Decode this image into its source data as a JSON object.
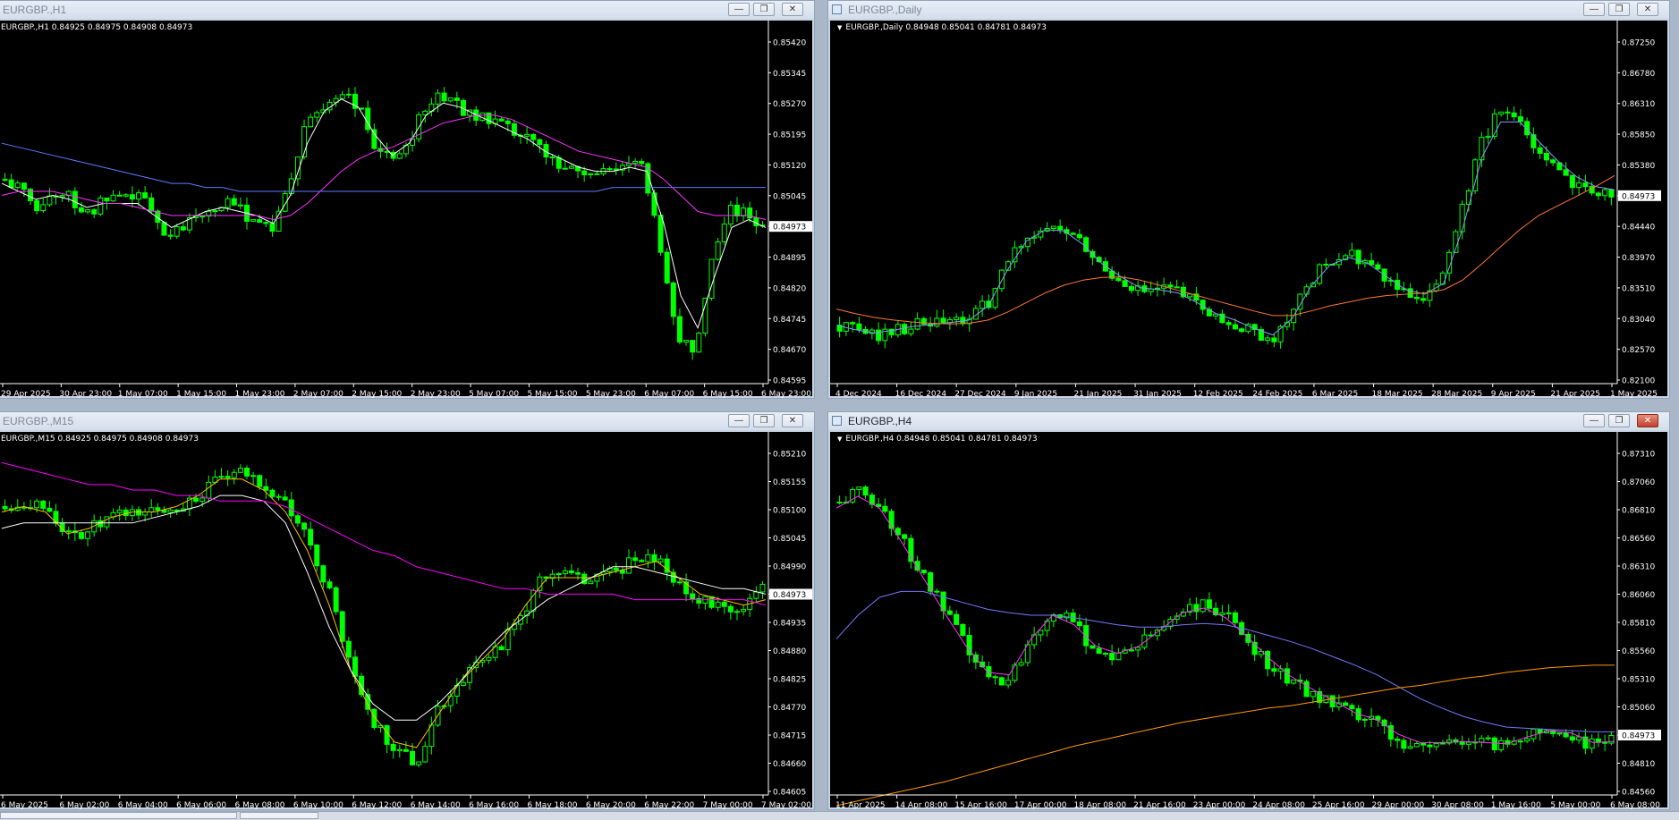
{
  "windows": [
    {
      "id": "h1",
      "title": "EURGBP.,H1",
      "info": "EURGBP.,H1  0.84925 0.84975 0.84908 0.84973",
      "active": false,
      "price_labels": [
        "0.85420",
        "0.85345",
        "0.85270",
        "0.85195",
        "0.85120",
        "0.85045",
        "0.84973",
        "0.84895",
        "0.84820",
        "0.84745",
        "0.84670",
        "0.84595"
      ],
      "current_price": "0.84973",
      "time_labels": [
        "29 Apr 2025",
        "30 Apr 23:00",
        "1 May 07:00",
        "1 May 15:00",
        "1 May 23:00",
        "2 May 07:00",
        "2 May 15:00",
        "2 May 23:00",
        "5 May 07:00",
        "5 May 15:00",
        "5 May 23:00",
        "6 May 07:00",
        "6 May 15:00",
        "6 May 23:00"
      ],
      "chart_data": {
        "type": "candlestick",
        "symbol": "EURGBP.",
        "timeframe": "H1",
        "ylim": [
          0.8459,
          0.8545
        ],
        "close_path": [
          0.8509,
          0.8506,
          0.8502,
          0.8506,
          0.8504,
          0.85,
          0.8504,
          0.8503,
          0.8506,
          0.8498,
          0.8495,
          0.85,
          0.8502,
          0.8503,
          0.8501,
          0.8499,
          0.8497,
          0.8509,
          0.8524,
          0.8527,
          0.8531,
          0.8527,
          0.8517,
          0.8513,
          0.8519,
          0.8528,
          0.853,
          0.8527,
          0.8525,
          0.8523,
          0.8521,
          0.8519,
          0.8516,
          0.8513,
          0.8511,
          0.851,
          0.8512,
          0.8513,
          0.8511,
          0.849,
          0.847,
          0.8466,
          0.849,
          0.8502,
          0.85,
          0.8497
        ],
        "ma_fast": [
          0.8508,
          0.8506,
          0.8504,
          0.8505,
          0.8504,
          0.8502,
          0.8503,
          0.8503,
          0.8503,
          0.85,
          0.8497,
          0.8499,
          0.8501,
          0.8502,
          0.8501,
          0.85,
          0.8498,
          0.8505,
          0.8518,
          0.8526,
          0.8529,
          0.8527,
          0.852,
          0.8515,
          0.8518,
          0.8525,
          0.8528,
          0.8527,
          0.8525,
          0.8523,
          0.8521,
          0.8519,
          0.8516,
          0.8514,
          0.8512,
          0.8511,
          0.8511,
          0.8512,
          0.8511,
          0.8498,
          0.848,
          0.8472,
          0.8485,
          0.8497,
          0.8499,
          0.8497
        ],
        "ma_mid": [
          0.8505,
          0.8506,
          0.8506,
          0.8506,
          0.8505,
          0.8504,
          0.8503,
          0.8503,
          0.8502,
          0.8501,
          0.85,
          0.85,
          0.85,
          0.85,
          0.85,
          0.85,
          0.8499,
          0.85,
          0.8503,
          0.8507,
          0.8511,
          0.8514,
          0.8516,
          0.8517,
          0.8519,
          0.8521,
          0.8523,
          0.8524,
          0.8525,
          0.8525,
          0.8524,
          0.8522,
          0.852,
          0.8518,
          0.8516,
          0.8515,
          0.8514,
          0.8513,
          0.8512,
          0.8509,
          0.8505,
          0.8501,
          0.85,
          0.85,
          0.85,
          0.8499
        ],
        "ma_slow": [
          0.8518,
          0.8517,
          0.8516,
          0.8515,
          0.8514,
          0.8513,
          0.8512,
          0.8511,
          0.851,
          0.8509,
          0.8508,
          0.8508,
          0.8507,
          0.8507,
          0.8506,
          0.8506,
          0.8506,
          0.8506,
          0.8506,
          0.8506,
          0.8506,
          0.8506,
          0.8506,
          0.8506,
          0.8506,
          0.8506,
          0.8506,
          0.8506,
          0.8506,
          0.8506,
          0.8506,
          0.8506,
          0.8506,
          0.8506,
          0.8506,
          0.8506,
          0.8507,
          0.8507,
          0.8507,
          0.8507,
          0.8507,
          0.8507,
          0.8507,
          0.8507,
          0.8507,
          0.8507
        ]
      }
    },
    {
      "id": "daily",
      "title": "EURGBP.,Daily",
      "info": "EURGBP.,Daily  0.84948 0.85041 0.84781 0.84973",
      "active": false,
      "price_labels": [
        "0.87250",
        "0.86780",
        "0.86310",
        "0.85850",
        "0.85380",
        "0.84973",
        "0.84440",
        "0.83970",
        "0.83510",
        "0.83040",
        "0.82570",
        "0.82100"
      ],
      "current_price": "0.84973",
      "time_labels": [
        "4 Dec 2024",
        "16 Dec 2024",
        "27 Dec 2024",
        "9 Jan 2025",
        "21 Jan 2025",
        "31 Jan 2025",
        "12 Feb 2025",
        "24 Feb 2025",
        "6 Mar 2025",
        "18 Mar 2025",
        "28 Mar 2025",
        "9 Apr 2025",
        "21 Apr 2025",
        "1 May 2025"
      ],
      "chart_data": {
        "type": "candlestick",
        "symbol": "EURGBP.",
        "timeframe": "Daily",
        "ylim": [
          0.8205,
          0.874
        ],
        "close_path": [
          0.829,
          0.8282,
          0.8275,
          0.8285,
          0.829,
          0.8292,
          0.8295,
          0.83,
          0.833,
          0.839,
          0.843,
          0.844,
          0.8435,
          0.841,
          0.8375,
          0.836,
          0.834,
          0.8345,
          0.834,
          0.832,
          0.83,
          0.8295,
          0.828,
          0.827,
          0.831,
          0.836,
          0.839,
          0.84,
          0.8385,
          0.836,
          0.834,
          0.8335,
          0.836,
          0.846,
          0.857,
          0.862,
          0.861,
          0.857,
          0.854,
          0.851,
          0.85,
          0.8497
        ],
        "ma_fast": [
          0.829,
          0.8283,
          0.8278,
          0.8282,
          0.8288,
          0.8291,
          0.8294,
          0.8298,
          0.832,
          0.8375,
          0.842,
          0.8438,
          0.8436,
          0.8415,
          0.8385,
          0.8365,
          0.8348,
          0.8345,
          0.834,
          0.8325,
          0.8308,
          0.8298,
          0.8285,
          0.8275,
          0.83,
          0.835,
          0.8383,
          0.8395,
          0.8386,
          0.8365,
          0.8345,
          0.8338,
          0.8355,
          0.844,
          0.855,
          0.8605,
          0.8605,
          0.8575,
          0.8545,
          0.852,
          0.8505,
          0.85
        ],
        "ma_slow": [
          0.8315,
          0.8308,
          0.8302,
          0.8298,
          0.8295,
          0.8293,
          0.8292,
          0.8293,
          0.8298,
          0.831,
          0.8325,
          0.834,
          0.8352,
          0.836,
          0.8364,
          0.8365,
          0.836,
          0.8352,
          0.8344,
          0.8336,
          0.8328,
          0.832,
          0.8312,
          0.8305,
          0.8305,
          0.8312,
          0.832,
          0.8326,
          0.8332,
          0.8336,
          0.8338,
          0.834,
          0.8345,
          0.836,
          0.8385,
          0.8412,
          0.8438,
          0.846,
          0.8475,
          0.849,
          0.8505,
          0.8522
        ]
      }
    },
    {
      "id": "m15",
      "title": "EURGBP.,M15",
      "info": "EURGBP.,M15  0.84925 0.84975 0.84908 0.84973",
      "active": false,
      "price_labels": [
        "0.85210",
        "0.85155",
        "0.85100",
        "0.85045",
        "0.84990",
        "0.84973",
        "0.84935",
        "0.84880",
        "0.84825",
        "0.84770",
        "0.84715",
        "0.84660",
        "0.84605"
      ],
      "current_price": "0.84973",
      "time_labels": [
        "6 May 2025",
        "6 May 02:00",
        "6 May 04:00",
        "6 May 06:00",
        "6 May 08:00",
        "6 May 10:00",
        "6 May 12:00",
        "6 May 14:00",
        "6 May 16:00",
        "6 May 18:00",
        "6 May 20:00",
        "6 May 22:00",
        "7 May 00:00",
        "7 May 02:00"
      ],
      "chart_data": {
        "type": "candlestick",
        "symbol": "EURGBP.",
        "timeframe": "M15",
        "ylim": [
          0.846,
          0.8523
        ],
        "close_path": [
          0.8512,
          0.8513,
          0.8512,
          0.8506,
          0.8508,
          0.851,
          0.8511,
          0.8511,
          0.8512,
          0.8514,
          0.8517,
          0.8518,
          0.8516,
          0.8512,
          0.8506,
          0.8496,
          0.8482,
          0.8473,
          0.8468,
          0.8465,
          0.8475,
          0.848,
          0.8484,
          0.8487,
          0.8493,
          0.85,
          0.8499,
          0.8499,
          0.85,
          0.8502,
          0.8503,
          0.8498,
          0.8494,
          0.8495,
          0.8493,
          0.8497
        ],
        "ma_fast": [
          0.8511,
          0.8512,
          0.8511,
          0.8507,
          0.8508,
          0.851,
          0.8511,
          0.8511,
          0.8512,
          0.8514,
          0.8517,
          0.8517,
          0.8515,
          0.8511,
          0.8504,
          0.8494,
          0.8482,
          0.8474,
          0.8469,
          0.8468,
          0.8474,
          0.848,
          0.8484,
          0.8488,
          0.8494,
          0.8499,
          0.8499,
          0.8499,
          0.85,
          0.8501,
          0.8502,
          0.8499,
          0.8496,
          0.8495,
          0.8494,
          0.8495
        ],
        "ma_mid": [
          0.8508,
          0.8509,
          0.8509,
          0.8509,
          0.8509,
          0.8509,
          0.8509,
          0.851,
          0.8511,
          0.8512,
          0.8514,
          0.8514,
          0.8513,
          0.8509,
          0.85,
          0.849,
          0.8482,
          0.8476,
          0.8473,
          0.8473,
          0.8476,
          0.848,
          0.8485,
          0.8489,
          0.8492,
          0.8495,
          0.8497,
          0.8499,
          0.8501,
          0.8501,
          0.85,
          0.8499,
          0.8498,
          0.8497,
          0.8497,
          0.8496
        ],
        "ma_slow": [
          0.852,
          0.8519,
          0.8518,
          0.8517,
          0.8516,
          0.8516,
          0.8515,
          0.8515,
          0.8514,
          0.8514,
          0.8513,
          0.8513,
          0.8513,
          0.8512,
          0.851,
          0.8508,
          0.8506,
          0.8504,
          0.8503,
          0.8501,
          0.85,
          0.8499,
          0.8498,
          0.8497,
          0.8497,
          0.8496,
          0.8496,
          0.8496,
          0.8496,
          0.8495,
          0.8495,
          0.8495,
          0.8495,
          0.8495,
          0.8495,
          0.8494
        ]
      }
    },
    {
      "id": "h4",
      "title": "EURGBP.,H4",
      "info": "EURGBP.,H4  0.84948 0.85041 0.84781 0.84973",
      "active": true,
      "price_labels": [
        "0.87310",
        "0.87060",
        "0.86810",
        "0.86560",
        "0.86310",
        "0.86060",
        "0.85810",
        "0.85560",
        "0.85310",
        "0.85060",
        "0.84973",
        "0.84810",
        "0.84560"
      ],
      "current_price": "0.84973",
      "time_labels": [
        "11 Apr 2025",
        "14 Apr 08:00",
        "15 Apr 16:00",
        "17 Apr 00:00",
        "18 Apr 08:00",
        "21 Apr 16:00",
        "23 Apr 00:00",
        "24 Apr 08:00",
        "25 Apr 16:00",
        "29 Apr 00:00",
        "30 Apr 08:00",
        "1 May 16:00",
        "5 May 00:00",
        "6 May 08:00"
      ],
      "chart_data": {
        "type": "candlestick",
        "symbol": "EURGBP.",
        "timeframe": "H4",
        "ylim": [
          0.8452,
          0.8742
        ],
        "close_path": [
          0.8695,
          0.8705,
          0.869,
          0.866,
          0.863,
          0.86,
          0.857,
          0.8545,
          0.8548,
          0.8585,
          0.8605,
          0.859,
          0.857,
          0.8565,
          0.8575,
          0.859,
          0.8605,
          0.8608,
          0.86,
          0.858,
          0.856,
          0.8545,
          0.8535,
          0.8525,
          0.8515,
          0.851,
          0.8495,
          0.849,
          0.8492,
          0.8495,
          0.8492,
          0.8491,
          0.85,
          0.8505,
          0.85,
          0.849,
          0.8497
        ],
        "ma_fast": [
          0.869,
          0.87,
          0.869,
          0.8662,
          0.8632,
          0.8602,
          0.8574,
          0.8552,
          0.855,
          0.858,
          0.86,
          0.8592,
          0.8574,
          0.8568,
          0.8574,
          0.8588,
          0.8602,
          0.8606,
          0.8598,
          0.8582,
          0.8564,
          0.8549,
          0.8538,
          0.8528,
          0.8518,
          0.8512,
          0.85,
          0.8493,
          0.8493,
          0.8494,
          0.8493,
          0.8492,
          0.8498,
          0.8503,
          0.8501,
          0.8493,
          0.8494
        ],
        "ma_mid": [
          0.858,
          0.86,
          0.8615,
          0.862,
          0.862,
          0.8615,
          0.861,
          0.8605,
          0.8602,
          0.86,
          0.86,
          0.8598,
          0.8595,
          0.8592,
          0.859,
          0.859,
          0.8592,
          0.8593,
          0.8592,
          0.8588,
          0.8583,
          0.8578,
          0.8572,
          0.8565,
          0.8558,
          0.855,
          0.854,
          0.853,
          0.8522,
          0.8515,
          0.851,
          0.8506,
          0.8505,
          0.8504,
          0.8503,
          0.8502,
          0.8502
        ],
        "ma_slow": [
          0.844,
          0.8444,
          0.8448,
          0.8452,
          0.8456,
          0.846,
          0.8465,
          0.847,
          0.8475,
          0.848,
          0.8485,
          0.849,
          0.8494,
          0.8498,
          0.8502,
          0.8506,
          0.851,
          0.8513,
          0.8516,
          0.8519,
          0.8522,
          0.8524,
          0.8527,
          0.853,
          0.8533,
          0.8536,
          0.8539,
          0.8541,
          0.8544,
          0.8547,
          0.8549,
          0.8552,
          0.8554,
          0.8556,
          0.8557,
          0.8558,
          0.8558
        ]
      }
    }
  ],
  "colors": {
    "candle": "#00ff00",
    "chart_bg": "#000000",
    "h1_ma_fast": "#ffffff",
    "h1_ma_mid": "#ff33ff",
    "h1_ma_slow": "#5b7cff",
    "daily_ma_fast": "#8899ff",
    "daily_ma_slow": "#ff7733",
    "m15_ma_fast": "#ffbb00",
    "m15_ma_mid": "#ffffff",
    "m15_ma_slow": "#ff00ff",
    "h4_ma_fast": "#ff33ff",
    "h4_ma_mid": "#7777ff",
    "h4_ma_slow": "#ff9900"
  },
  "icons": {
    "chart": "chart-window-icon",
    "minimize": "minimize-icon",
    "restore": "restore-icon",
    "close": "close-icon"
  },
  "buttons": {
    "minimize": "—",
    "restore": "❐",
    "close": "✕"
  }
}
